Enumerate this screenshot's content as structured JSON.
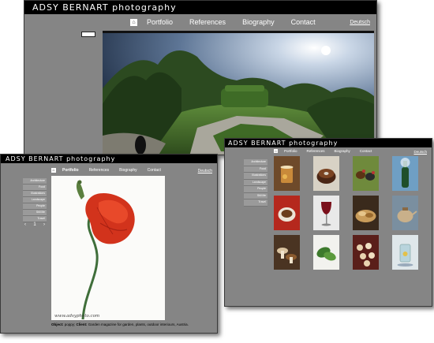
{
  "brand": {
    "name": "ADSY BERNART",
    "suffix": " photography"
  },
  "nav": {
    "home_glyph": "⌂",
    "items": [
      "Portfolio",
      "References",
      "Biography",
      "Contact"
    ],
    "language": "Deutsch"
  },
  "portfolio_categories": [
    "Architecture",
    "Food",
    "Illustrations",
    "Landscape",
    "People",
    "Still life",
    "Travel"
  ],
  "pager": {
    "prev": "‹",
    "current": "1",
    "next": "›"
  },
  "caption": {
    "object_label": "Object:",
    "object_value": " poppy; ",
    "client_label": "Client:",
    "client_value": " Garden magazine for garden, plants, outdoor interiours, Austria.",
    "watermark": "www.adsyphoto.com"
  },
  "thumbnail_subjects": [
    "tea-glass",
    "bundt-cake",
    "chickens",
    "bottle-splash",
    "coffee-cup",
    "wine-glass",
    "pastry",
    "teapot",
    "mushrooms",
    "spinach-leaves",
    "biscuits",
    "water-glass"
  ],
  "colors": {
    "window_bg": "#858585",
    "title_bg": "#000000",
    "poppy": "#d2331c",
    "stem": "#3f6e3a"
  }
}
